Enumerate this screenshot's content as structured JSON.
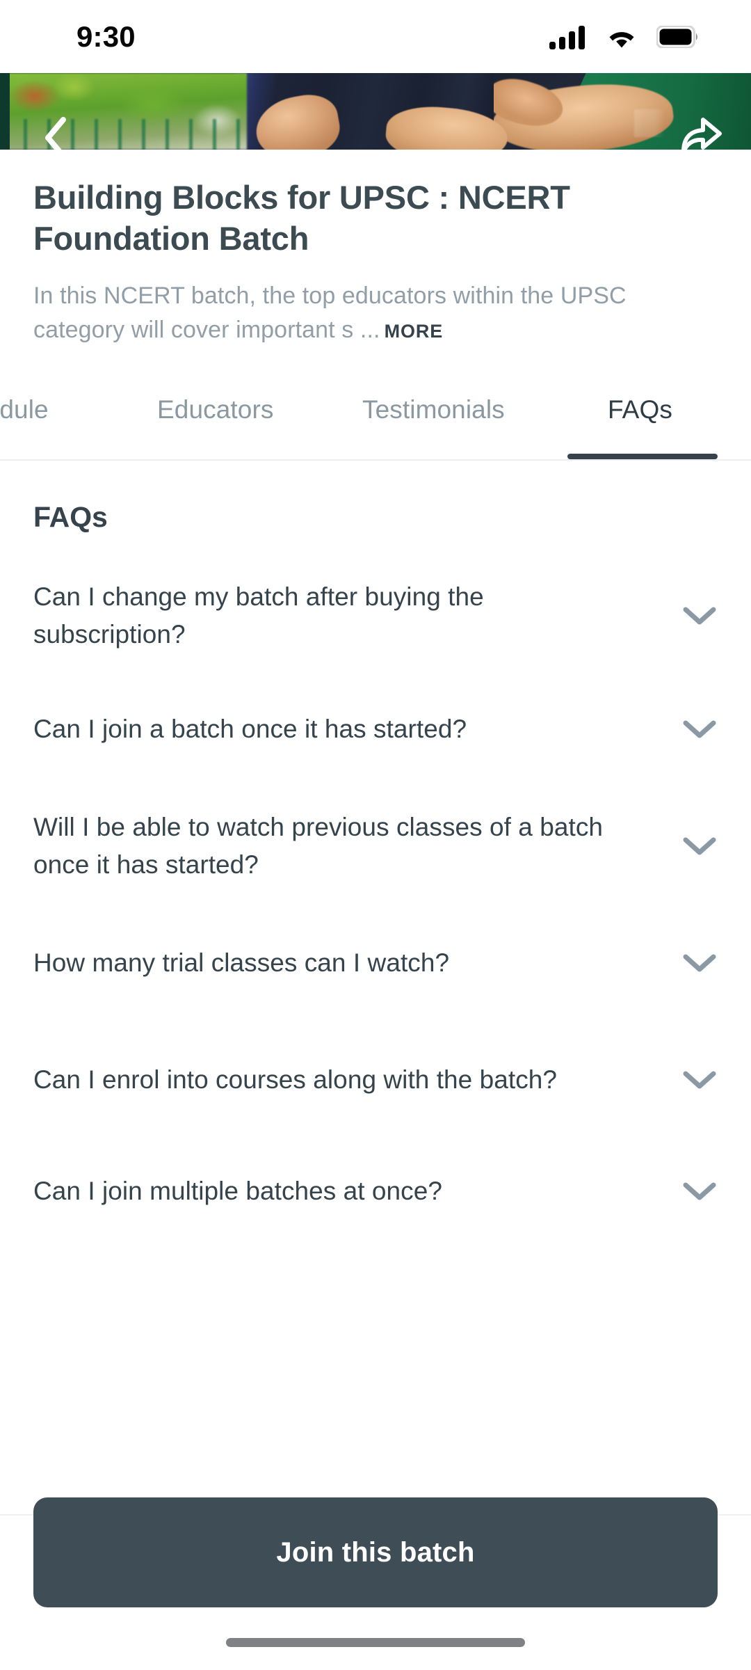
{
  "status_bar": {
    "time": "9:30",
    "icons": [
      "cellular-signal-icon",
      "wifi-icon",
      "battery-icon"
    ]
  },
  "hero": {
    "back_icon": "back-chevron-icon",
    "share_icon": "share-icon"
  },
  "course": {
    "title": "Building Blocks for UPSC : NCERT Foundation Batch",
    "description": "In this NCERT batch, the top educators within the UPSC category will cover important s ...",
    "more_label": "MORE"
  },
  "tabs": {
    "items": [
      {
        "label": "hedule",
        "active": false
      },
      {
        "label": "Educators",
        "active": false
      },
      {
        "label": "Testimonials",
        "active": false
      },
      {
        "label": "FAQs",
        "active": true
      }
    ]
  },
  "faqs": {
    "heading": "FAQs",
    "chevron_icon": "chevron-down-icon",
    "items": [
      {
        "question": "Can I change my batch after buying the subscription?"
      },
      {
        "question": "Can I join a batch once it has started?"
      },
      {
        "question": "Will I be able to watch previous classes of a batch once it has started?"
      },
      {
        "question": "How many trial classes can I watch?"
      },
      {
        "question": "Can I enrol into courses along with the batch?"
      },
      {
        "question": "Can I join multiple batches at once?"
      }
    ]
  },
  "footer": {
    "cta_label": "Join this batch"
  },
  "colors": {
    "text_primary": "#36434c",
    "text_muted": "#929ea7",
    "accent_dark": "#3f4d56",
    "chevron": "#8a99a3",
    "divider": "#edeff1"
  }
}
